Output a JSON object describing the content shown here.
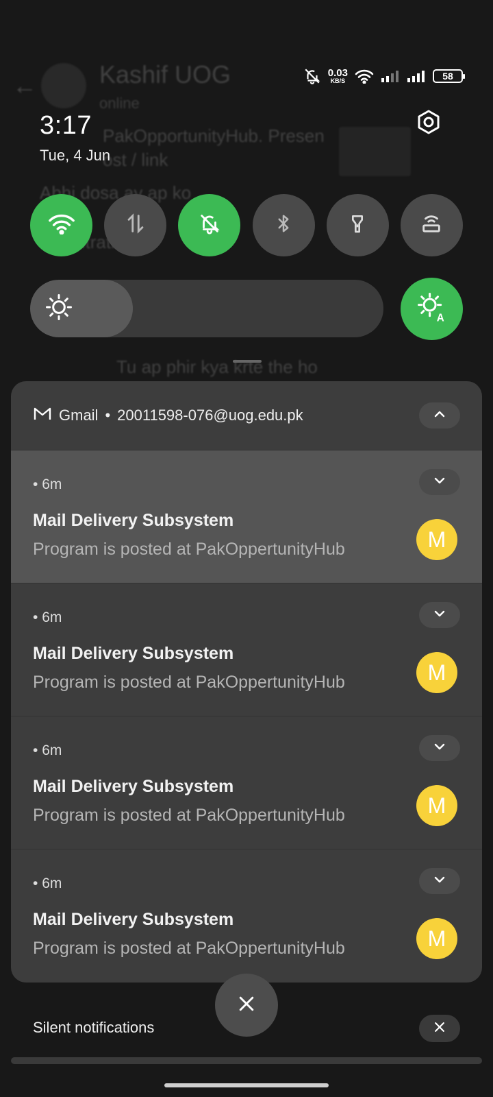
{
  "background_app": {
    "contact_name": "Kashif UOG",
    "contact_status": "online",
    "messages": [
      "PakOpportunityHub. Presen",
      "ost / link",
      "Abhi dosa ay ap ko",
      "Registration ...",
      "Tu ap phir kya krte the ho"
    ]
  },
  "status_bar": {
    "net_speed_value": "0.03",
    "net_speed_unit": "KB/S",
    "battery_level": "58"
  },
  "header": {
    "time": "3:17",
    "date": "Tue, 4 Jun"
  },
  "quick_tiles": [
    {
      "name": "wifi",
      "icon": "wifi-icon",
      "active": true
    },
    {
      "name": "mobile-data",
      "icon": "data-arrows-icon",
      "active": false
    },
    {
      "name": "silent",
      "icon": "bell-off-icon",
      "active": true
    },
    {
      "name": "bluetooth",
      "icon": "bluetooth-icon",
      "active": false
    },
    {
      "name": "flashlight",
      "icon": "flashlight-icon",
      "active": false
    },
    {
      "name": "hotspot",
      "icon": "hotspot-icon",
      "active": false
    }
  ],
  "brightness": {
    "level": 0.29,
    "auto": true
  },
  "notification_group": {
    "app_name": "Gmail",
    "account": "20011598-076@uog.edu.pk",
    "items": [
      {
        "time": "6m",
        "sender": "Mail Delivery Subsystem",
        "preview": "Program is posted at PakOppertunityHub",
        "avatar_letter": "M"
      },
      {
        "time": "6m",
        "sender": "Mail Delivery Subsystem",
        "preview": "Program is posted at PakOppertunityHub",
        "avatar_letter": "M"
      },
      {
        "time": "6m",
        "sender": "Mail Delivery Subsystem",
        "preview": "Program is posted at PakOppertunityHub",
        "avatar_letter": "M"
      },
      {
        "time": "6m",
        "sender": "Mail Delivery Subsystem",
        "preview": "Program is posted at PakOppertunityHub",
        "avatar_letter": "M"
      }
    ]
  },
  "silent_section": {
    "label": "Silent notifications"
  },
  "colors": {
    "accent_green": "#3cba54",
    "avatar_yellow": "#f8d23a",
    "panel": "#3d3d3d"
  }
}
